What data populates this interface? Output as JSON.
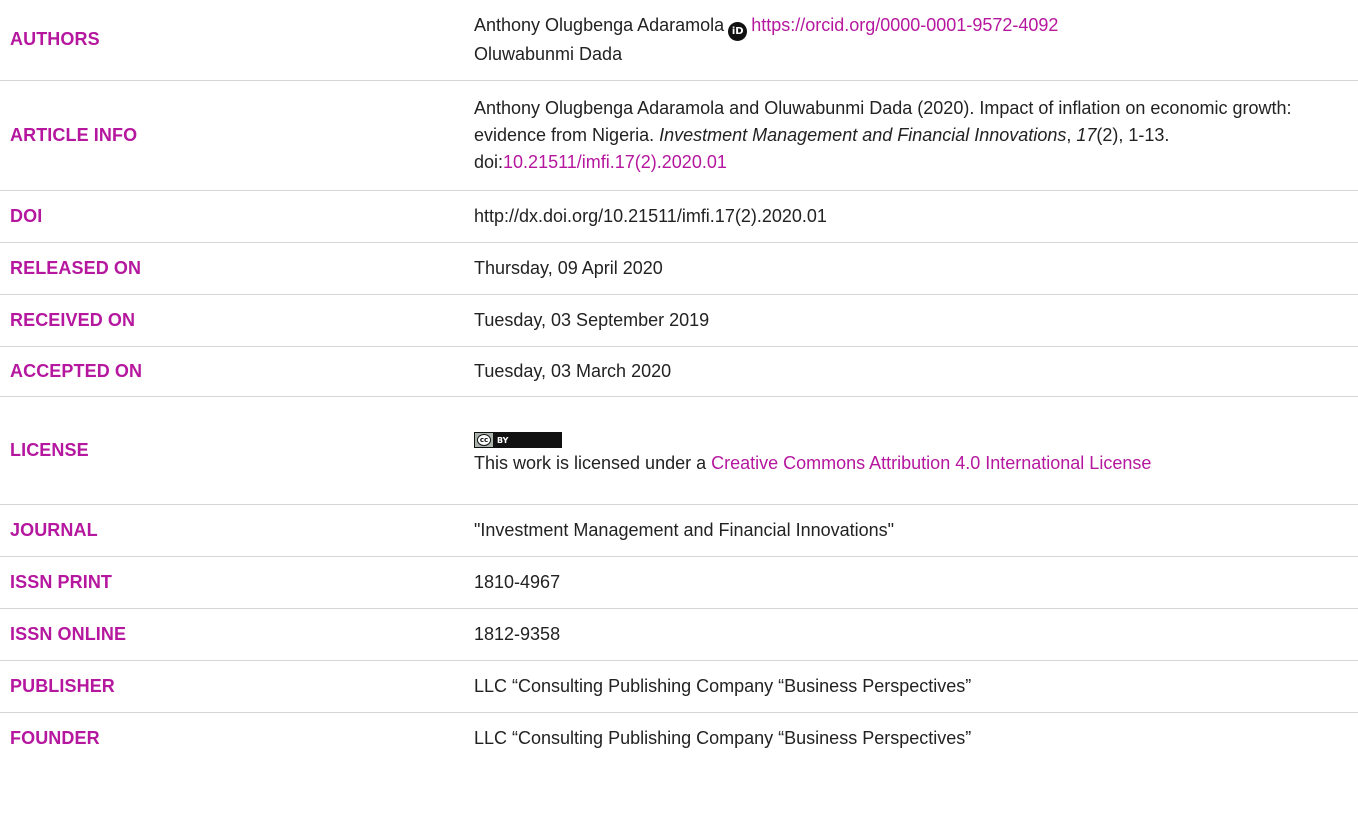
{
  "colors": {
    "accent": "#b5179e",
    "text": "#222222",
    "divider": "#d6d6d6"
  },
  "rows": {
    "authors": {
      "label": "AUTHORS",
      "author1": "Anthony Olugbenga Adaramola",
      "orcid_icon": "orcid-icon",
      "orcid_glyph": "iD",
      "orcid_link": "https://orcid.org/0000-0001-9572-4092",
      "author2": "Oluwabunmi Dada"
    },
    "article_info": {
      "label": "ARTICLE INFO",
      "citation_pre": "Anthony Olugbenga Adaramola and Oluwabunmi Dada (2020). Impact of inflation on economic growth: evidence from Nigeria. ",
      "journal_italic": "Investment Management and Financial Innovations",
      "comma": ", ",
      "volume_italic": "17",
      "citation_post": "(2), 1-13. doi:",
      "doi_link": "10.21511/imfi.17(2).2020.01"
    },
    "doi": {
      "label": "DOI",
      "value": "http://dx.doi.org/10.21511/imfi.17(2).2020.01"
    },
    "released": {
      "label": "RELEASED ON",
      "value": "Thursday, 09 April 2020"
    },
    "received": {
      "label": "RECEIVED ON",
      "value": "Tuesday, 03 September 2019"
    },
    "accepted": {
      "label": "ACCEPTED ON",
      "value": "Tuesday, 03 March 2020"
    },
    "license": {
      "label": "LICENSE",
      "badge_cc": "cc",
      "badge_by": "BY",
      "text_pre": "This work is licensed under a ",
      "link": "Creative Commons Attribution 4.0 International License"
    },
    "journal": {
      "label": "JOURNAL",
      "value": "\"Investment Management and Financial Innovations\""
    },
    "issn_print": {
      "label": "ISSN PRINT",
      "value": "1810-4967"
    },
    "issn_online": {
      "label": "ISSN ONLINE",
      "value": "1812-9358"
    },
    "publisher": {
      "label": "PUBLISHER",
      "value": "LLC “Consulting Publishing Company “Business Perspectives”"
    },
    "founder": {
      "label": "FOUNDER",
      "value": "LLC “Consulting Publishing Company “Business Perspectives”"
    }
  }
}
